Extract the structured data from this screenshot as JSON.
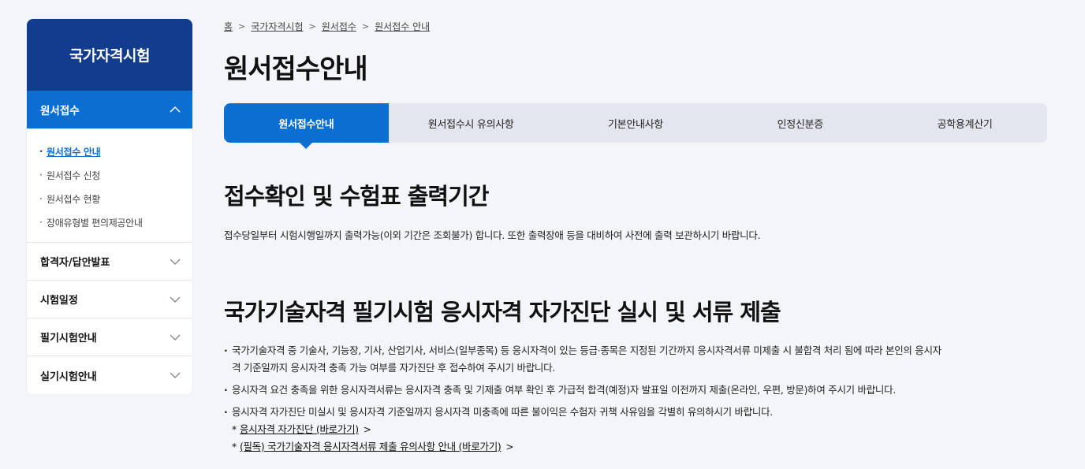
{
  "sidebar": {
    "title": "국가자격시험",
    "active_section": "원서접수",
    "sub_items": [
      {
        "label": "원서접수 안내"
      },
      {
        "label": "원서접수 신청"
      },
      {
        "label": "원서접수 현황"
      },
      {
        "label": "장애유형별 편의제공안내"
      }
    ],
    "menus": [
      {
        "label": "합격자/답안발표"
      },
      {
        "label": "시험일정"
      },
      {
        "label": "필기시험안내"
      },
      {
        "label": "실기시험안내"
      }
    ]
  },
  "breadcrumb": [
    "홈",
    "국가자격시험",
    "원서접수",
    "원서접수 안내"
  ],
  "page_title": "원서접수안내",
  "tabs": [
    {
      "label": "원서접수안내"
    },
    {
      "label": "원서접수시 유의사항"
    },
    {
      "label": "기본안내사항"
    },
    {
      "label": "인정신분증"
    },
    {
      "label": "공학용계산기"
    }
  ],
  "section1": {
    "heading": "접수확인 및 수험표 출력기간",
    "text": "접수당일부터 시험시행일까지 출력가능(이외 기간은 조회불가) 합니다. 또한 출력장애 등을 대비하여 사전에 출력 보관하시기 바랍니다."
  },
  "section2": {
    "heading": "국가기술자격 필기시험 응시자격 자가진단 실시 및 서류 제출",
    "bullets": [
      {
        "line1": "국가기술자격 중 기술사, 기능장, 기사, 산업기사, 서비스(일부종목) 등 응시자격이 있는 등급·종목은 지정된 기간까지 응시자격서류 미제출 시 불합격 처리 됨에 따라 본인의 응시자",
        "line2": "격 기준일까지 응시자격 충족 가능 여부를 자가진단 후 접수하여 주시기 바랍니다."
      },
      {
        "line1": "응시자격 요건 충족을 위한 응시자격서류는 응시자격 충족 및 기제출 여부 확인 후 가급적 합격(예정)자 발표일 이전까지 제출(온라인, 우편, 방문)하여 주시기 바랍니다."
      },
      {
        "line1": "응시자격 자가진단 미실시 및 응시자격 기준일까지 응시자격 미충족에 따른 불이익은 수험자 귀책 사유임을 각별히 유의하시기 바랍니다."
      }
    ],
    "links": [
      {
        "star": "*",
        "label": "응시자격 자가진단 (바로가기)"
      },
      {
        "star": "*",
        "label": "(필독) 국가기술자격 응시자격서류 제출 유의사항 안내 (바로가기)"
      }
    ]
  },
  "colors": {
    "brand_navy": "#123d8c",
    "accent_blue": "#0b6fd1",
    "tab_bg": "#e3e6ee"
  }
}
